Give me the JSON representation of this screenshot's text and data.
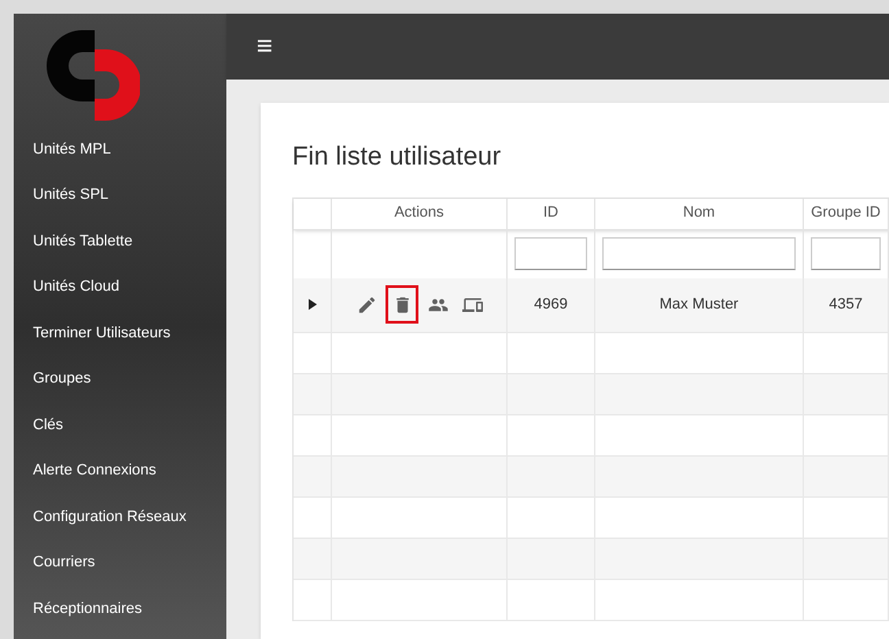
{
  "sidebar": {
    "items": [
      "Unités MPL",
      "Unités SPL",
      "Unités Tablette",
      "Unités Cloud",
      "Terminer Utilisateurs",
      "Groupes",
      "Clés",
      "Alerte Connexions",
      "Configuration Réseaux",
      "Courriers",
      "Réceptionnaires"
    ]
  },
  "topbar": {
    "menu_icon": "≡"
  },
  "card": {
    "title": "Fin liste utilisateur"
  },
  "table": {
    "columns": [
      "Actions",
      "ID",
      "Nom",
      "Groupe ID"
    ],
    "rows": [
      {
        "expanded": false,
        "actions": [
          {
            "kind": "edit",
            "highlighted": false
          },
          {
            "kind": "delete",
            "highlighted": true
          },
          {
            "kind": "group",
            "highlighted": false
          },
          {
            "kind": "devices",
            "highlighted": false
          }
        ],
        "cells": [
          "",
          "4969",
          "Max Muster",
          "4357"
        ]
      }
    ]
  }
}
